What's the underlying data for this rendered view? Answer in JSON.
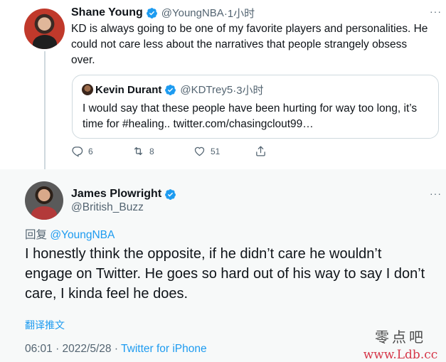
{
  "original_tweet": {
    "author_name": "Shane Young",
    "author_handle": "@YoungNBA",
    "time": "·1小时",
    "text": "KD is always going to be one of my favorite players and personalities. He could not care less about the narratives that people strangely obsess over.",
    "quoted": {
      "author_name": "Kevin Durant",
      "author_handle": "@KDTrey5",
      "time": "·3小时",
      "text": "I would say that these people have been hurting for way too long, it’s time for #healing.. twitter.com/chasingclout99…"
    },
    "actions": {
      "replies": "6",
      "retweets": "8",
      "likes": "51"
    }
  },
  "main_tweet": {
    "author_name": "James Plowright",
    "author_handle": "@British_Buzz",
    "reply_prefix": "回复 ",
    "reply_to": "@YoungNBA",
    "text": "I honestly think the opposite, if he didn’t care he wouldn’t engage on Twitter. He goes so hard out of his way to say I don’t care, I kinda feel he does.",
    "translate_label": "翻译推文",
    "timestamp": "06:01 · 2022/5/28 · ",
    "source": "Twitter for iPhone"
  },
  "watermark": {
    "line1": "零点吧",
    "line2": "www.Ldb.cc"
  },
  "colors": {
    "accent": "#1d9bf0",
    "secondary_text": "#536471",
    "highlight_bg": "#f7f9f9"
  }
}
